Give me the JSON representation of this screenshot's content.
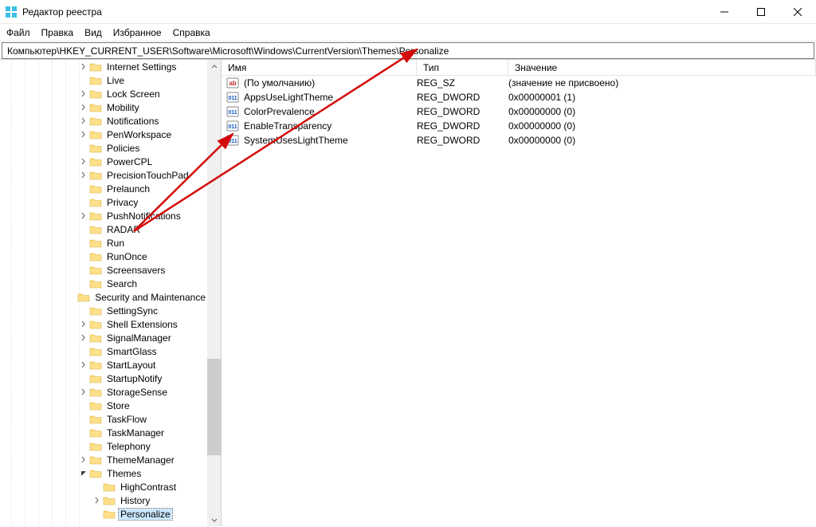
{
  "window": {
    "title": "Редактор реестра"
  },
  "menubar": {
    "items": [
      "Файл",
      "Правка",
      "Вид",
      "Избранное",
      "Справка"
    ]
  },
  "addressbar": {
    "path": "Компьютер\\HKEY_CURRENT_USER\\Software\\Microsoft\\Windows\\CurrentVersion\\Themes\\Personalize"
  },
  "tree": {
    "base_indent": 97,
    "indent_step": 17,
    "items": [
      {
        "depth": 0,
        "expander": ">",
        "label": "Internet Settings"
      },
      {
        "depth": 0,
        "expander": "",
        "label": "Live"
      },
      {
        "depth": 0,
        "expander": ">",
        "label": "Lock Screen"
      },
      {
        "depth": 0,
        "expander": ">",
        "label": "Mobility"
      },
      {
        "depth": 0,
        "expander": ">",
        "label": "Notifications"
      },
      {
        "depth": 0,
        "expander": ">",
        "label": "PenWorkspace"
      },
      {
        "depth": 0,
        "expander": "",
        "label": "Policies"
      },
      {
        "depth": 0,
        "expander": ">",
        "label": "PowerCPL"
      },
      {
        "depth": 0,
        "expander": ">",
        "label": "PrecisionTouchPad"
      },
      {
        "depth": 0,
        "expander": "",
        "label": "Prelaunch"
      },
      {
        "depth": 0,
        "expander": "",
        "label": "Privacy"
      },
      {
        "depth": 0,
        "expander": ">",
        "label": "PushNotifications"
      },
      {
        "depth": 0,
        "expander": "",
        "label": "RADAR"
      },
      {
        "depth": 0,
        "expander": "",
        "label": "Run"
      },
      {
        "depth": 0,
        "expander": "",
        "label": "RunOnce"
      },
      {
        "depth": 0,
        "expander": "",
        "label": "Screensavers"
      },
      {
        "depth": 0,
        "expander": "",
        "label": "Search"
      },
      {
        "depth": 0,
        "expander": "",
        "label": "Security and Maintenance"
      },
      {
        "depth": 0,
        "expander": "",
        "label": "SettingSync"
      },
      {
        "depth": 0,
        "expander": ">",
        "label": "Shell Extensions"
      },
      {
        "depth": 0,
        "expander": ">",
        "label": "SignalManager"
      },
      {
        "depth": 0,
        "expander": "",
        "label": "SmartGlass"
      },
      {
        "depth": 0,
        "expander": ">",
        "label": "StartLayout"
      },
      {
        "depth": 0,
        "expander": "",
        "label": "StartupNotify"
      },
      {
        "depth": 0,
        "expander": ">",
        "label": "StorageSense"
      },
      {
        "depth": 0,
        "expander": "",
        "label": "Store"
      },
      {
        "depth": 0,
        "expander": "",
        "label": "TaskFlow"
      },
      {
        "depth": 0,
        "expander": "",
        "label": "TaskManager"
      },
      {
        "depth": 0,
        "expander": "",
        "label": "Telephony"
      },
      {
        "depth": 0,
        "expander": ">",
        "label": "ThemeManager"
      },
      {
        "depth": 0,
        "expander": "v",
        "label": "Themes"
      },
      {
        "depth": 1,
        "expander": "",
        "label": "HighContrast"
      },
      {
        "depth": 1,
        "expander": ">",
        "label": "History"
      },
      {
        "depth": 1,
        "expander": "",
        "label": "Personalize",
        "selected": true
      }
    ]
  },
  "details": {
    "columns": {
      "name": "Имя",
      "type": "Тип",
      "value": "Значение"
    },
    "rows": [
      {
        "icon": "ab",
        "name": "(По умолчанию)",
        "type": "REG_SZ",
        "value": "(значение не присвоено)"
      },
      {
        "icon": "010",
        "name": "AppsUseLightTheme",
        "type": "REG_DWORD",
        "value": "0x00000001 (1)"
      },
      {
        "icon": "010",
        "name": "ColorPrevalence",
        "type": "REG_DWORD",
        "value": "0x00000000 (0)"
      },
      {
        "icon": "010",
        "name": "EnableTransparency",
        "type": "REG_DWORD",
        "value": "0x00000000 (0)"
      },
      {
        "icon": "010",
        "name": "SystemUsesLightTheme",
        "type": "REG_DWORD",
        "value": "0x00000000 (0)"
      }
    ]
  },
  "annotations": {
    "arrow_color": "#d40a0a"
  }
}
